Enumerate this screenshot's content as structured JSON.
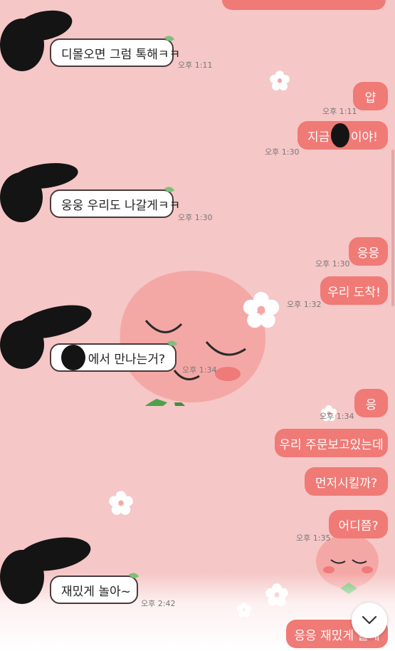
{
  "messages": [
    {
      "text": "",
      "time": ""
    },
    {
      "text": "디몰오면 그럼 톡해ㅋㅋ",
      "time": "오후 1:11"
    },
    {
      "text": "얍",
      "time": "오후 1:11"
    },
    {
      "text": "지금",
      "text2": "이야!",
      "time": "오후 1:30"
    },
    {
      "text": "웅웅 우리도 나갈게ㅋㅋ",
      "time": "오후 1:30"
    },
    {
      "text": "응응",
      "time": "오후 1:30"
    },
    {
      "text": "우리 도착!",
      "time": "오후 1:32"
    },
    {
      "text": "에서 만나는거?",
      "time": "오후 1:34"
    },
    {
      "text": "응",
      "time": "오후 1:34"
    },
    {
      "text": "우리 주문보고있는데",
      "time": ""
    },
    {
      "text": "먼저시킬까?",
      "time": ""
    },
    {
      "text": "어디쯤?",
      "time": "오후 1:35"
    },
    {
      "text": "재밌게 놀아~",
      "time": "오후 2:42"
    },
    {
      "text": "응응 재밌게 놀게",
      "time": ""
    }
  ],
  "icons": {
    "scroll_down": "chevron-down-icon",
    "leaf": "leaf-icon"
  },
  "colors": {
    "background": "#f6c7c7",
    "outgoing_bubble": "#f07a76",
    "incoming_bubble": "#ffffff"
  }
}
